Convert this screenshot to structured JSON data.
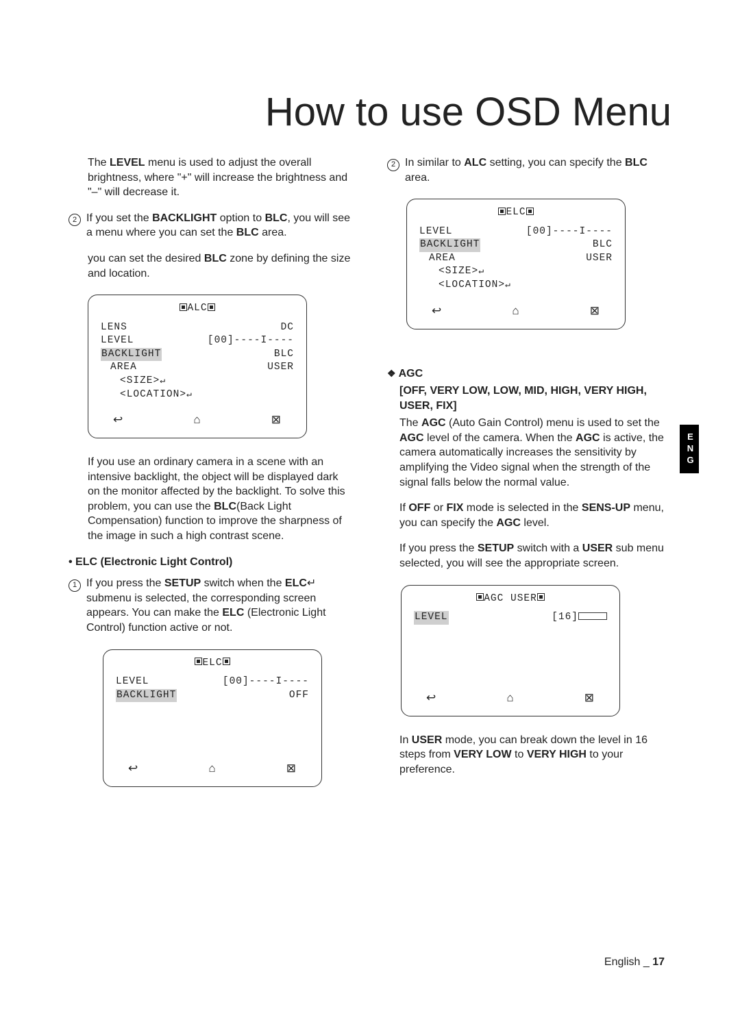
{
  "title": "How to use OSD Menu",
  "left": {
    "p1": "The LEVEL menu is used to adjust the overall brightness, where \"+\" will increase the brightness and \"–\" will decrease it.",
    "n2a": "If you set the BACKLIGHT option to BLC, you will see a menu where you can set the BLC area.",
    "sub2a": "you can set the desired BLC zone by defining the size and location.",
    "osd1_title": "ALC",
    "osd1": {
      "lens_l": "LENS",
      "lens_r": "DC",
      "level_l": "LEVEL",
      "level_r": "[00]----I----",
      "back_l": "BACKLIGHT",
      "back_r": "BLC",
      "area_l": "AREA",
      "area_r": "USER",
      "size": "<SIZE>",
      "loc": "<LOCATION>"
    },
    "p_after_osd1": "If you use an ordinary camera in a scene with an intensive backlight, the object will be displayed dark on the monitor affected by the backlight. To solve this problem, you can use the BLC(Back Light Compensation) function to improve the sharpness of the image in such a high contrast scene.",
    "elc_head": "• ELC (Electronic Light Control)",
    "n1b": "If you press the SETUP switch when the ELC↵ submenu is selected, the corresponding screen appears. You can make the ELC (Electronic Light Control) function active or not.",
    "osd2_title": "ELC",
    "osd2": {
      "level_l": "LEVEL",
      "level_r": "[00]----I----",
      "back_l": "BACKLIGHT",
      "back_r": "OFF"
    }
  },
  "right": {
    "n2c": "In similar to ALC setting, you can specify the BLC area.",
    "osd3_title": "ELC",
    "osd3": {
      "level_l": "LEVEL",
      "level_r": "[00]----I----",
      "back_l": "BACKLIGHT",
      "back_r": "BLC",
      "area_l": "AREA",
      "area_r": "USER",
      "size": "<SIZE>",
      "loc": "<LOCATION>"
    },
    "agc_head": "AGC",
    "agc_sub": "[OFF, VERY LOW, LOW, MID, HIGH, VERY HIGH, USER, FIX]",
    "agc_p1": "The AGC (Auto Gain Control) menu is used to set the AGC level of the camera. When the AGC is active, the camera automatically increases the sensitivity by amplifying the Video signal when the strength of the signal falls below the normal value.",
    "agc_p2": "If OFF or FIX mode is selected in the SENS-UP menu, you can specify the AGC level.",
    "agc_p3": "If you press the SETUP switch with a USER sub menu selected, you will see the appropriate screen.",
    "osd4_title": "AGC USER",
    "osd4": {
      "level_l": "LEVEL",
      "level_r": "[16]"
    },
    "p_after_osd4": "In USER mode, you can break down the level in 16 steps from VERY LOW to VERY HIGH to your preference."
  },
  "sidetab": "ENG",
  "footer_lang": "English",
  "footer_page": "17",
  "icons": {
    "back": "↩",
    "home": "⌂",
    "close": "⊠",
    "enter": "↵"
  }
}
